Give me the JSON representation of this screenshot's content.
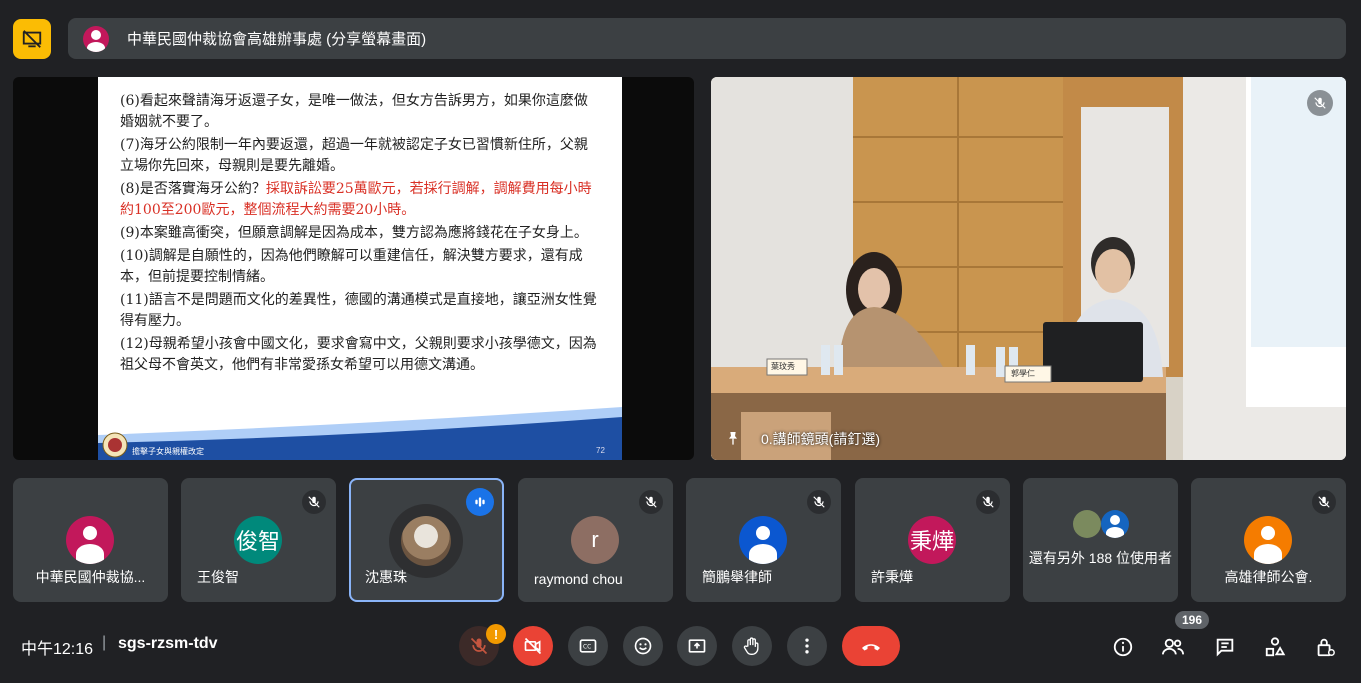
{
  "header": {
    "meeting_title": "中華民國仲裁協會高雄辦事處 (分享螢幕畫面)"
  },
  "slide": {
    "paragraphs": [
      {
        "plain": "(6)看起來聲請海牙返還子女，是唯一做法，但女方告訴男方，如果你這麼做婚姻就不要了。",
        "red": ""
      },
      {
        "plain": "(7)海牙公約限制一年內要返還，超過一年就被認定子女已習慣新住所，父親立場你先回來，母親則是要先離婚。",
        "red": ""
      },
      {
        "plain": "(8)是否落實海牙公約？",
        "red": "採取訴訟要25萬歐元，若採行調解，調解費用每小時約100至200歐元，整個流程大約需要20小時。"
      },
      {
        "plain": "(9)本案雖高衝突，但願意調解是因為成本，雙方認為應將錢花在子女身上。",
        "red": ""
      },
      {
        "plain": "(10)調解是自願性的，因為他們瞭解可以重建信任，解決雙方要求，還有成本，但前提要控制情緒。",
        "red": ""
      },
      {
        "plain": "(11)語言不是問題而文化的差異性，德國的溝通模式是直接地，讓亞洲女性覺得有壓力。",
        "red": ""
      },
      {
        "plain": "(12)母親希望小孩會中國文化，要求會寫中文，父親則要求小孩學德文，因為祖父母不會英文，他們有非常愛孫女希望可以用德文溝通。",
        "red": ""
      }
    ],
    "footer_label": "擔擊子女與親權改定",
    "page_number": "72"
  },
  "video": {
    "label": "0.講師鏡頭(請釘選)",
    "nameplate_left": "葉玟秀",
    "nameplate_right": "郭學仁"
  },
  "participants": [
    {
      "name": "中華民國仲裁協...",
      "avatar_type": "person",
      "color": "#c2185b",
      "initial": "",
      "muted": false
    },
    {
      "name": "王俊智",
      "avatar_type": "initial",
      "color": "#00897b",
      "initial": "俊智",
      "muted": true
    },
    {
      "name": "沈惠珠",
      "avatar_type": "photo",
      "color": "#5f6368",
      "initial": "",
      "muted": false,
      "speaking": true
    },
    {
      "name": "raymond chou",
      "avatar_type": "initial",
      "color": "#8d6e63",
      "initial": "r",
      "muted": true
    },
    {
      "name": "簡鵬舉律師",
      "avatar_type": "person",
      "color": "#0b57d0",
      "initial": "",
      "muted": true
    },
    {
      "name": "許秉燁",
      "avatar_type": "initial",
      "color": "#c2185b",
      "initial": "秉燁",
      "muted": true
    },
    {
      "name": "還有另外 188 位使用者",
      "avatar_type": "group",
      "color": "#1565c0",
      "initial": "",
      "muted": false
    },
    {
      "name": "高雄律師公會.",
      "avatar_type": "person",
      "color": "#f57c00",
      "initial": "",
      "muted": true
    }
  ],
  "bottom": {
    "time": "中午12:16",
    "separator": "|",
    "meeting_code": "sgs-rzsm-tdv",
    "mic_warning": "!",
    "participant_count": "196"
  },
  "colors": {
    "background": "#202124",
    "tile": "#3c4043",
    "danger": "#ea4335",
    "accent_yellow": "#fbbc04",
    "speaking_border": "#8ab4f8"
  }
}
